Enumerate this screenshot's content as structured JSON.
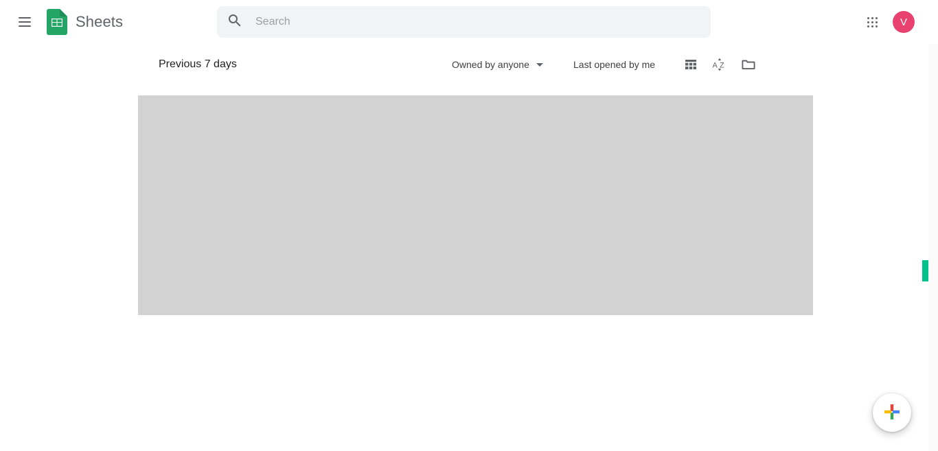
{
  "header": {
    "menu_icon": "hamburger-menu-icon",
    "logo_icon": "google-sheets-logo-icon",
    "title": "Sheets",
    "search": {
      "icon": "search-icon",
      "placeholder": "Search",
      "value": ""
    },
    "apps_icon": "google-apps-grid-icon",
    "avatar": {
      "initial": "V",
      "color": "#e8416f"
    }
  },
  "toolbar": {
    "section_title": "Previous 7 days",
    "owner_filter": {
      "label": "Owned by anyone",
      "caret_icon": "chevron-down-icon"
    },
    "sort_label": "Last opened by me",
    "grid_view_icon": "grid-view-icon",
    "sort_az_icon": "sort-a-z-icon",
    "folder_icon": "folder-icon"
  },
  "content": {
    "placeholder_color": "#d2d2d2"
  },
  "scrollbar": {
    "thumb_color": "#00c28c"
  },
  "fab": {
    "icon": "google-plus-create-icon",
    "colors": {
      "red": "#ea4335",
      "yellow": "#fbbc04",
      "blue": "#4285f4",
      "green": "#34a853"
    }
  }
}
